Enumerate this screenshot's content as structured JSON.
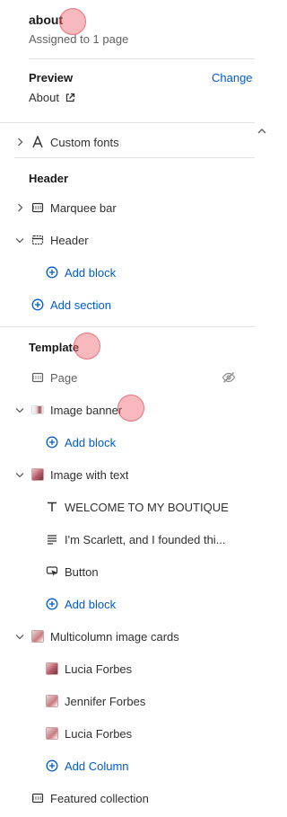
{
  "page": {
    "title": "about",
    "assigned": "Assigned to 1 page"
  },
  "preview": {
    "label": "Preview",
    "change": "Change",
    "page": "About"
  },
  "custom_fonts": "Custom fonts",
  "header_group": {
    "title": "Header",
    "items": [
      "Marquee bar",
      "Header"
    ],
    "add_block": "Add block",
    "add_section": "Add section"
  },
  "template": {
    "title": "Template",
    "page": "Page",
    "image_banner": "Image banner",
    "image_banner_add": "Add block",
    "image_with_text": "Image with text",
    "iwt_blocks": [
      "WELCOME TO MY BOUTIQUE",
      "I'm Scarlett, and I founded thi...",
      "Button"
    ],
    "iwt_add": "Add block",
    "multicolumn": "Multicolumn image cards",
    "columns": [
      "Lucia Forbes",
      "Jennifer Forbes",
      "Lucia Forbes"
    ],
    "add_column": "Add Column",
    "featured": "Featured collection"
  },
  "colors": {
    "link": "#005bd3",
    "divider": "#e3e3e3",
    "cursor_marker": "#f0646e"
  },
  "icons": {
    "chevron_right": "chevron-right-icon",
    "chevron_down": "chevron-down-icon",
    "external": "external-link-icon",
    "plus_circle": "plus-circle-icon",
    "eye_off": "eye-off-icon"
  }
}
